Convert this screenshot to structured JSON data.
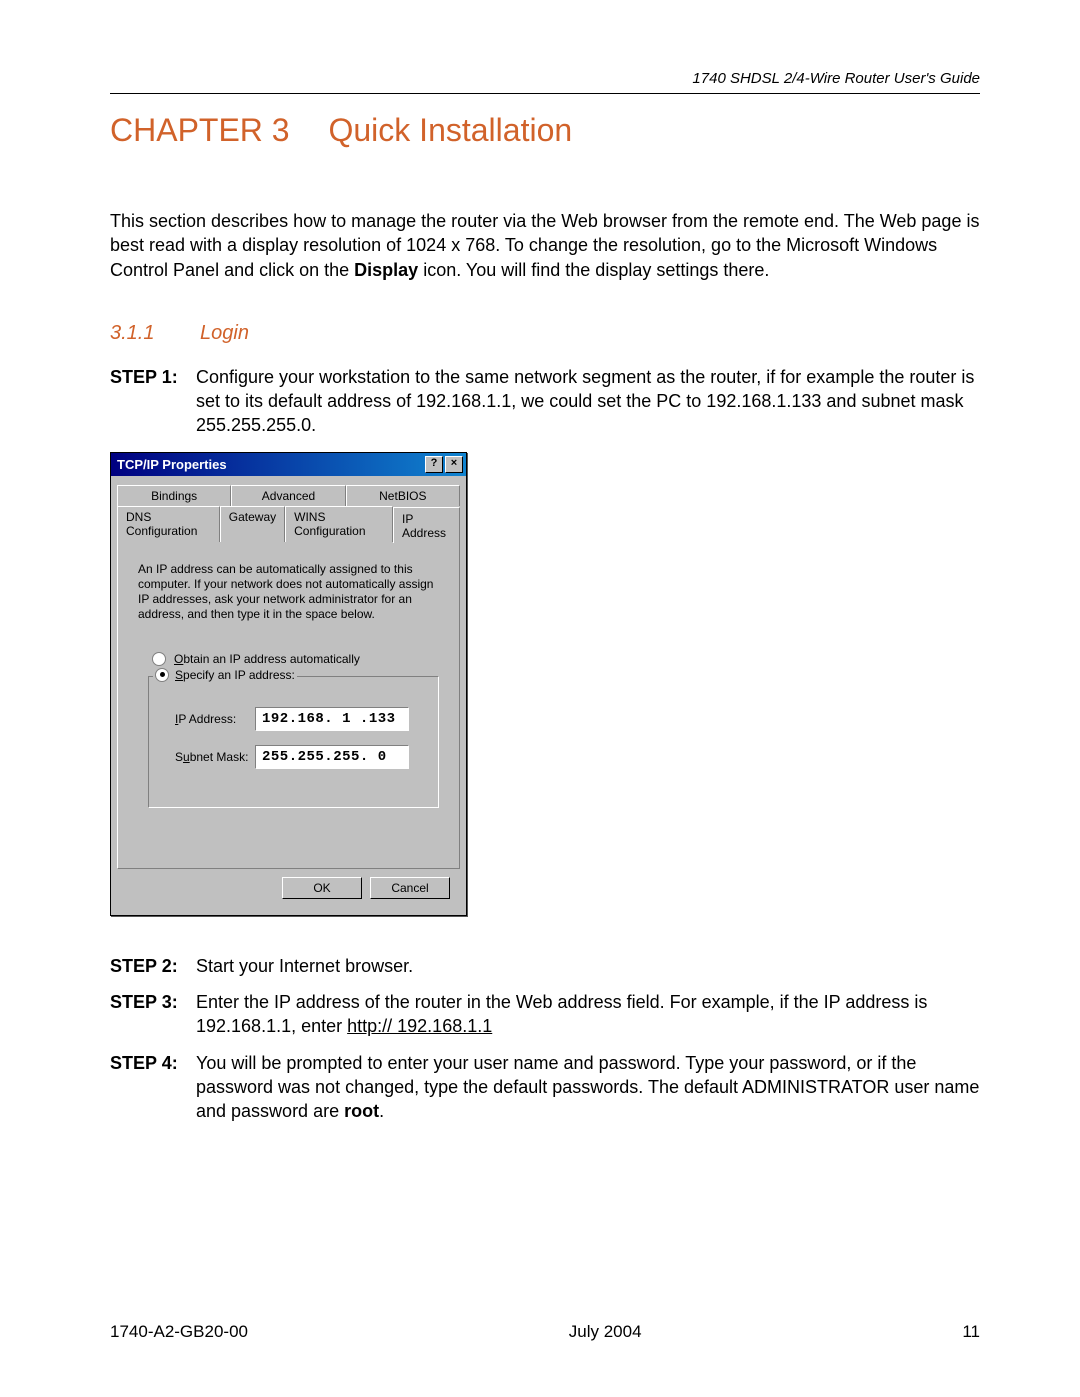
{
  "header": {
    "doc_title": "1740 SHDSL 2/4-Wire Router User's Guide"
  },
  "chapter": {
    "label": "CHAPTER 3",
    "title": "Quick Installation"
  },
  "intro": {
    "pre": "This section describes how to manage the router via the Web browser from the remote end. The Web page is best read with a display resolution of 1024 x 768. To change the resolution, go to the Microsoft Windows Control Panel and click on the ",
    "bold": "Display",
    "post": " icon. You will find the display settings there."
  },
  "section": {
    "number": "3.1.1",
    "title": "Login"
  },
  "steps": {
    "s1": {
      "label": "STEP 1:",
      "body": "Configure your workstation to the same network segment as the router, if for example the router is set to its default address of 192.168.1.1, we could set the PC to 192.168.1.133 and subnet mask 255.255.255.0."
    },
    "s2": {
      "label": "STEP 2:",
      "body": "Start your Internet browser."
    },
    "s3": {
      "label": "STEP 3:",
      "pre": "Enter the IP address of the router in the Web address field. For example, if the IP address is 192.168.1.1, enter ",
      "link": "http:// 192.168.1.1"
    },
    "s4": {
      "label": "STEP 4:",
      "pre": "You will be prompted to enter your user name and password. Type your password, or if the password was not changed, type the default passwords. The default ADMINISTRATOR user name and password are ",
      "bold": "root",
      "post": "."
    }
  },
  "dialog": {
    "title": "TCP/IP Properties",
    "help_glyph": "?",
    "close_glyph": "×",
    "tabs_back": [
      "Bindings",
      "Advanced",
      "NetBIOS"
    ],
    "tabs_front": [
      "DNS Configuration",
      "Gateway",
      "WINS Configuration",
      "IP Address"
    ],
    "panel_text": "An IP address can be automatically assigned to this computer. If your network does not automatically assign IP addresses, ask your network administrator for an address, and then type it in the space below.",
    "radio_auto_pre": "O",
    "radio_auto_label": "btain an IP address automatically",
    "radio_spec_pre": "S",
    "radio_spec_label": "pecify an IP address:",
    "ip_label_pre": "I",
    "ip_label": "P Address:",
    "ip_value": "192.168. 1 .133",
    "subnet_label_pre": "S",
    "subnet_label": "ubnet Mask:",
    "subnet_value": "255.255.255. 0",
    "ok": "OK",
    "cancel": "Cancel"
  },
  "footer": {
    "left": "1740-A2-GB20-00",
    "center": "July 2004",
    "right": "11"
  }
}
